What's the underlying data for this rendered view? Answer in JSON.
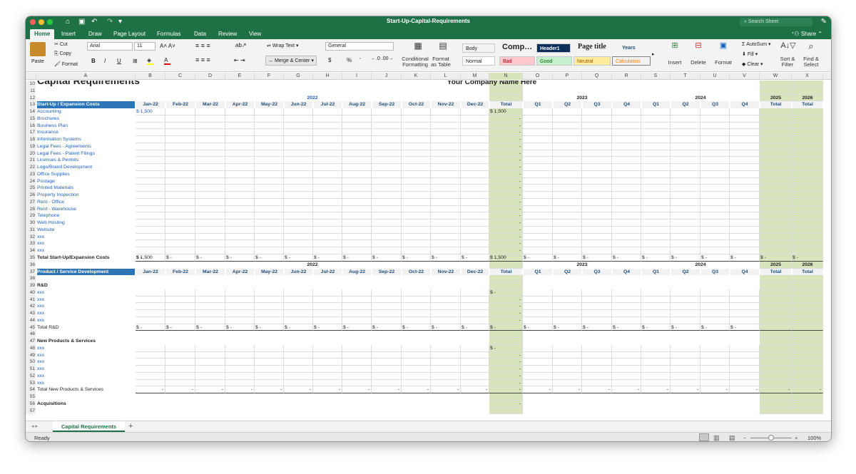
{
  "window": {
    "title": "Start-Up-Capital-Requirements",
    "search_placeholder": "Search Sheet",
    "share_label": "Share"
  },
  "ribbon_tabs": [
    "Home",
    "Insert",
    "Draw",
    "Page Layout",
    "Formulas",
    "Data",
    "Review",
    "View"
  ],
  "ribbon": {
    "paste": "Paste",
    "cut": "Cut",
    "copy": "Copy",
    "format": "Format",
    "font": "Arial",
    "size": "11",
    "bold": "B",
    "italic": "I",
    "underline": "U",
    "wrap": "Wrap Text",
    "merge": "Merge & Center",
    "number_format": "General",
    "dollar": "$",
    "percent": "%",
    "comma": "’",
    "cond": "Conditional Formatting",
    "fmt_table": "Format as Table",
    "styles": [
      {
        "label": "Body",
        "bg": "#ffffff",
        "fg": "#000000"
      },
      {
        "label": "Comp…",
        "bg": "#f3f3f3",
        "fg": "#000000"
      },
      {
        "label": "Header1",
        "bg": "#0b2f5a",
        "fg": "#ffffff"
      },
      {
        "label": "Page title",
        "bg": "#f3f3f3",
        "fg": "#000000"
      },
      {
        "label": "Years",
        "bg": "#f3f3f3",
        "fg": "#1f4e79"
      },
      {
        "label": "Normal",
        "bg": "#ffffff",
        "fg": "#000000"
      },
      {
        "label": "Bad",
        "bg": "#ffc7ce",
        "fg": "#9c0006"
      },
      {
        "label": "Good",
        "bg": "#c6efce",
        "fg": "#006100"
      },
      {
        "label": "Neutral",
        "bg": "#ffeb9c",
        "fg": "#9c5700"
      },
      {
        "label": "Calculation",
        "bg": "#f2f2f2",
        "fg": "#fa7d00"
      }
    ],
    "insert": "Insert",
    "delete": "Delete",
    "format_cells": "Format",
    "autosum": "AutoSum",
    "fill": "Fill",
    "clear": "Clear",
    "sort": "Sort & Filter",
    "find": "Find & Select"
  },
  "columns": [
    "A",
    "B",
    "C",
    "D",
    "E",
    "F",
    "G",
    "H",
    "I",
    "J",
    "K",
    "L",
    "M",
    "N",
    "O",
    "P",
    "Q",
    "R",
    "S",
    "T",
    "U",
    "V",
    "W",
    "X"
  ],
  "sheet": {
    "title": "Capital Requirements",
    "company": "Your Company Name Here",
    "year_2022": "2022",
    "year_2023": "2023",
    "year_2024": "2024",
    "year_2025": "2025",
    "year_2026": "2026",
    "months": [
      "Jan-22",
      "Feb-22",
      "Mar-22",
      "Apr-22",
      "May-22",
      "Jun-22",
      "Jul-22",
      "Aug-22",
      "Sep-22",
      "Oct-22",
      "Nov-22",
      "Dec-22"
    ],
    "total": "Total",
    "quarters": [
      "Q1",
      "Q2",
      "Q3",
      "Q4"
    ],
    "section1": "Start-Up / Expansion Costs",
    "section1_items": [
      "Accounting",
      "Brochures",
      "Business Plan",
      "Insurance",
      "Information Systems",
      "Legal Fees - Agreements",
      "Legal Fees - Patent Filings",
      "Licenses & Permits",
      "Logo/Brand Development",
      "Office Supplies",
      "Postage",
      "Printed Materials",
      "Property Inspection",
      "Rent - Office",
      "Rent - Warehouse",
      "Telephone",
      "Web Hosting",
      "Website",
      "xxx",
      "xxx",
      "xxx"
    ],
    "accounting_value": "1,500",
    "currency": "$",
    "dash": "-",
    "section1_total": "Total Start-Up/Expansion Costs",
    "section2": "Product / Service Development",
    "rd": "R&D",
    "rd_items": [
      "xxx",
      "xxx",
      "xxx",
      "xxx",
      "xxx"
    ],
    "rd_total": "Total R&D",
    "np": "New Products & Services",
    "np_items": [
      "xxx",
      "xxx",
      "xxx",
      "xxx",
      "xxx",
      "xxx"
    ],
    "np_total": "Total New Products & Services",
    "acq": "Acquisitions"
  },
  "sheet_tab": "Capital Requirements",
  "status": {
    "ready": "Ready",
    "zoom": "100%"
  }
}
